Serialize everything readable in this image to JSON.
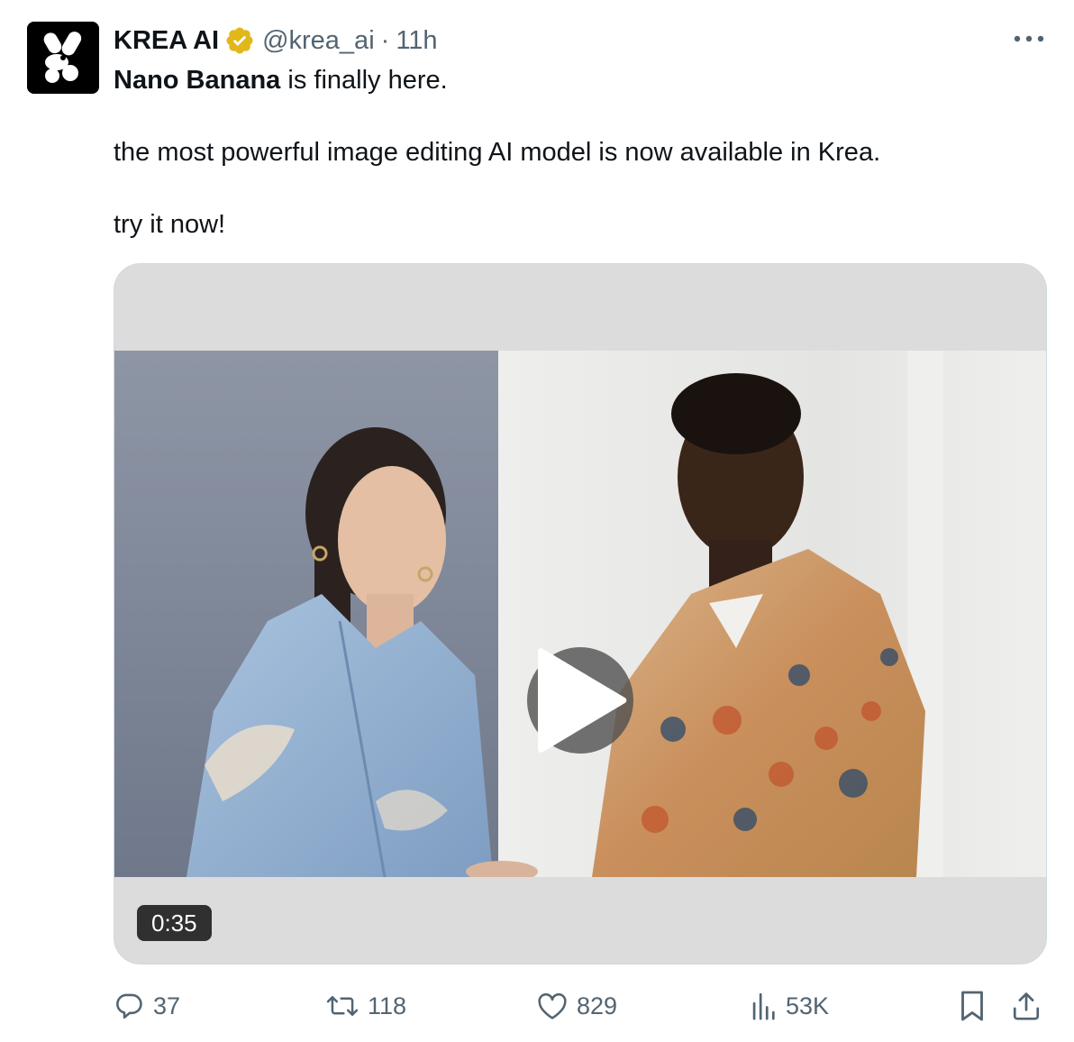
{
  "post": {
    "author_name": "KREA AI",
    "handle": "@krea_ai",
    "separator": "·",
    "time": "11h",
    "text": {
      "line1_bold": "Nano Banana",
      "line1_rest": " is finally here.",
      "line2": "the most powerful image editing AI model is now available in Krea.",
      "line3": "try it now!"
    },
    "media": {
      "type": "video",
      "duration": "0:35"
    },
    "stats": {
      "replies": "37",
      "reposts": "118",
      "likes": "829",
      "views": "53K"
    }
  },
  "icons": {
    "avatar": "krea-logo-icon",
    "verified": "verified-badge-icon",
    "more": "more-icon",
    "play": "play-icon",
    "reply": "reply-icon",
    "repost": "repost-icon",
    "like": "heart-icon",
    "views": "views-icon",
    "bookmark": "bookmark-icon",
    "share": "share-icon"
  },
  "colors": {
    "text": "#0f1419",
    "secondary": "#536471",
    "verified": "#e2b719",
    "border": "#cfd9de"
  }
}
